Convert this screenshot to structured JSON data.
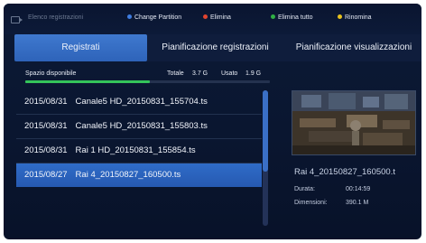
{
  "header": {
    "title": "Elenco registrazioni",
    "legend": [
      {
        "label": "Change Partition",
        "color": "#3f7de0"
      },
      {
        "label": "Elimina",
        "color": "#e0442f"
      },
      {
        "label": "Elimina tutto",
        "color": "#2fb044"
      },
      {
        "label": "Rinomina",
        "color": "#e8c21e"
      }
    ]
  },
  "tabs": [
    {
      "label": "Registrati",
      "active": true
    },
    {
      "label": "Pianificazione registrazioni",
      "active": false
    },
    {
      "label": "Pianificazione visualizzazioni",
      "active": false
    }
  ],
  "storage": {
    "label": "Spazio disponibile",
    "total_label": "Totale",
    "total_value": "3.7 G",
    "used_label": "Usato",
    "used_value": "1.9 G",
    "fill_fraction": 0.51,
    "fill_color": "#34c45a"
  },
  "recordings": [
    {
      "date": "2015/08/31",
      "name": "Canale5 HD_20150831_155704.ts",
      "selected": false
    },
    {
      "date": "2015/08/31",
      "name": "Canale5 HD_20150831_155803.ts",
      "selected": false
    },
    {
      "date": "2015/08/31",
      "name": "Rai 1 HD_20150831_155854.ts",
      "selected": false
    },
    {
      "date": "2015/08/27",
      "name": "Rai 4_20150827_160500.ts",
      "selected": true
    }
  ],
  "details": {
    "title": "Rai 4_20150827_160500.t",
    "duration_label": "Durata:",
    "duration_value": "00:14:59",
    "size_label": "Dimensioni:",
    "size_value": "390.1 M"
  },
  "colors": {
    "selected": "#2f6cc8",
    "background": "#0a1630"
  }
}
